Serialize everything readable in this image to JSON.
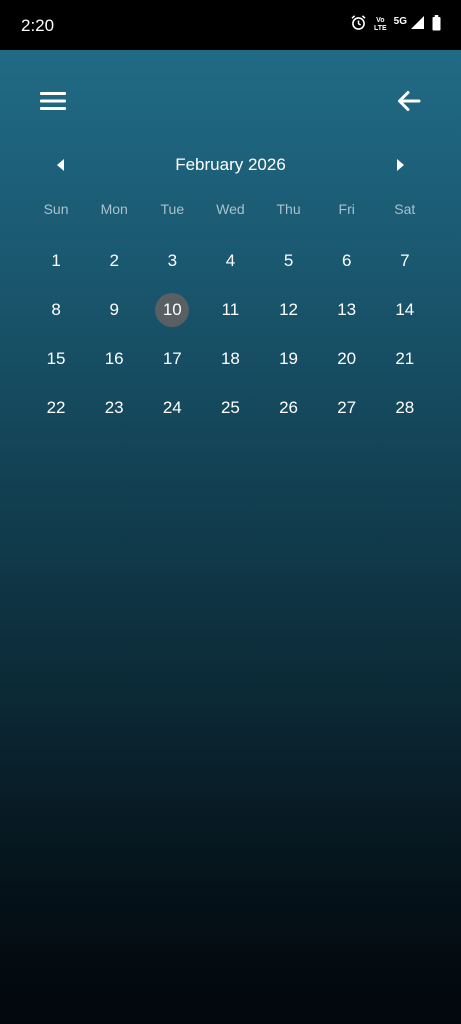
{
  "status_bar": {
    "time": "2:20",
    "volte_top": "Vo",
    "volte_bottom": "LTE",
    "network": "5G"
  },
  "toolbar": {
    "menu_icon": "hamburger-icon",
    "back_icon": "arrow-left-icon"
  },
  "calendar": {
    "month_label": "February 2026",
    "prev_icon": "triangle-left-icon",
    "next_icon": "triangle-right-icon",
    "weekdays": [
      "Sun",
      "Mon",
      "Tue",
      "Wed",
      "Thu",
      "Fri",
      "Sat"
    ],
    "weeks": [
      [
        "1",
        "2",
        "3",
        "4",
        "5",
        "6",
        "7"
      ],
      [
        "8",
        "9",
        "10",
        "11",
        "12",
        "13",
        "14"
      ],
      [
        "15",
        "16",
        "17",
        "18",
        "19",
        "20",
        "21"
      ],
      [
        "22",
        "23",
        "24",
        "25",
        "26",
        "27",
        "28"
      ]
    ],
    "selected_day": "10"
  },
  "colors": {
    "gradient_top": "#216a85",
    "gradient_bottom": "#02070b",
    "selected_circle": "#595f62",
    "weekday_text": "#a9c2cd"
  }
}
